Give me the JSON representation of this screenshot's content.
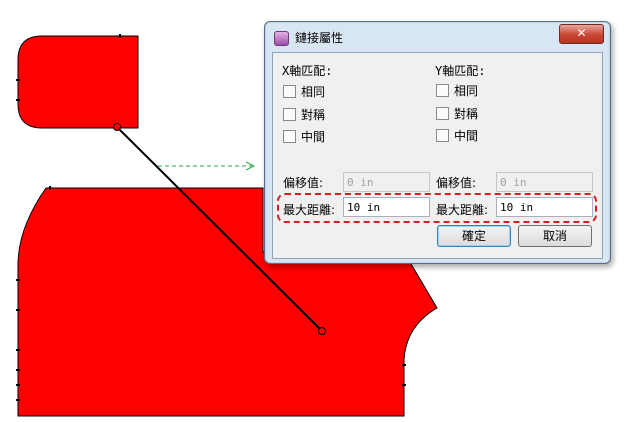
{
  "colors": {
    "piece_fill": "#ff0000",
    "outline": "#000000",
    "link_arrow": "#2aa84a",
    "highlight": "#d81e1e"
  },
  "dialog": {
    "title": "鏈接屬性",
    "close_label": "✕",
    "x_group": {
      "heading": "X軸匹配:",
      "options": [
        {
          "label": "相同",
          "checked": false
        },
        {
          "label": "對稱",
          "checked": false
        },
        {
          "label": "中間",
          "checked": false
        }
      ]
    },
    "y_group": {
      "heading": "Y軸匹配:",
      "options": [
        {
          "label": "相同",
          "checked": false
        },
        {
          "label": "對稱",
          "checked": false
        },
        {
          "label": "中間",
          "checked": false
        }
      ]
    },
    "x_offset": {
      "label": "偏移值:",
      "value": "0 in"
    },
    "y_offset": {
      "label": "偏移值:",
      "value": "0 in"
    },
    "x_max_distance": {
      "label": "最大距離:",
      "value": "10 in"
    },
    "y_max_distance": {
      "label": "最大距離:",
      "value": "10 in"
    },
    "ok_label": "確定",
    "cancel_label": "取消"
  }
}
